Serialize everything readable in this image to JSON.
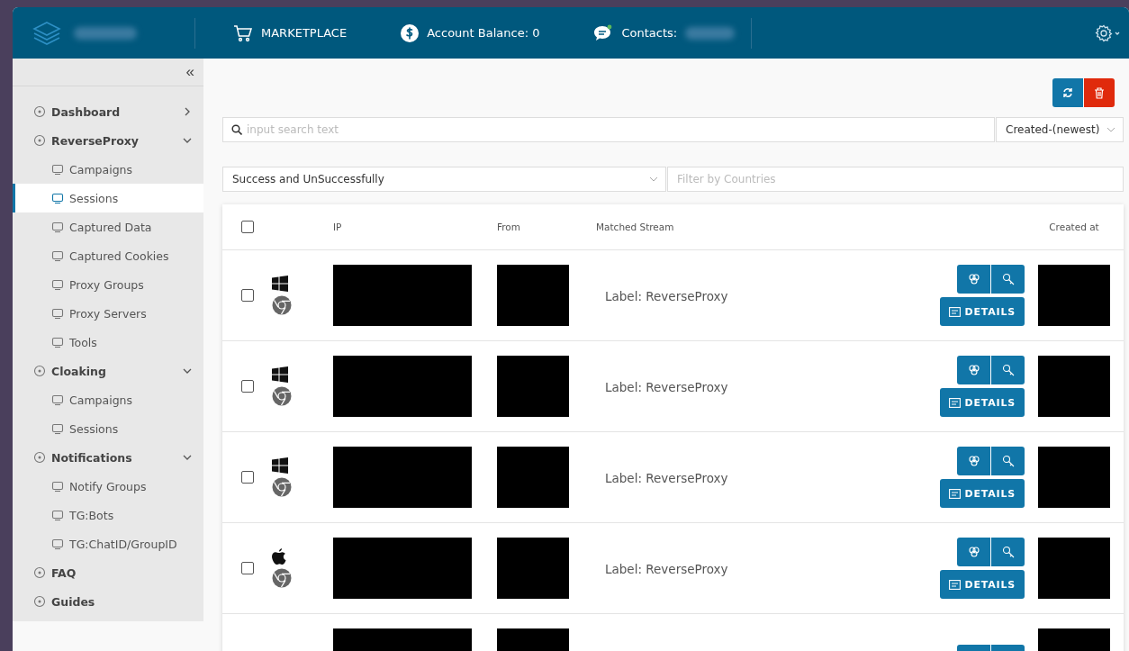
{
  "header": {
    "nav": [
      {
        "kind": "cart",
        "label": "MARKETPLACE"
      },
      {
        "kind": "dollar",
        "label": "Account Balance: 0"
      },
      {
        "kind": "chat",
        "label": "Contacts:"
      }
    ]
  },
  "sidebar": {
    "collapse": "«",
    "items": [
      {
        "label": "Dashboard",
        "expanded": false,
        "selected": false
      },
      {
        "label": "ReverseProxy",
        "expanded": true,
        "selected": false,
        "children": [
          {
            "label": "Campaigns",
            "selected": false
          },
          {
            "label": "Sessions",
            "selected": true
          },
          {
            "label": "Captured Data",
            "selected": false
          },
          {
            "label": "Captured Cookies",
            "selected": false
          },
          {
            "label": "Proxy Groups",
            "selected": false
          },
          {
            "label": "Proxy Servers",
            "selected": false
          },
          {
            "label": "Tools",
            "selected": false
          }
        ]
      },
      {
        "label": "Cloaking",
        "expanded": true,
        "selected": false,
        "children": [
          {
            "label": "Campaigns",
            "selected": false
          },
          {
            "label": "Sessions",
            "selected": false
          }
        ]
      },
      {
        "label": "Notifications",
        "expanded": true,
        "selected": false,
        "children": [
          {
            "label": "Notify Groups",
            "selected": false
          },
          {
            "label": "TG:Bots",
            "selected": false
          },
          {
            "label": "TG:ChatID/GroupID",
            "selected": false
          }
        ]
      },
      {
        "label": "FAQ",
        "selected": false
      },
      {
        "label": "Guides",
        "selected": false
      }
    ]
  },
  "search": {
    "placeholder": "input search text"
  },
  "sort": {
    "value": "Created-(newest)"
  },
  "status_filter": {
    "value": "Success and UnSuccessfully"
  },
  "country_filter": {
    "placeholder": "Filter by Countries"
  },
  "table": {
    "select_all": {
      "checked": false
    },
    "columns": [
      "IP",
      "From",
      "Matched Stream",
      "Created at"
    ],
    "rows": [
      {
        "checked": false,
        "os": {
          "kind": "windows"
        },
        "browser": {
          "kind": "chrome"
        },
        "stream": "Label: ReverseProxy",
        "action": "DETAILS"
      },
      {
        "checked": false,
        "os": {
          "kind": "windows"
        },
        "browser": {
          "kind": "chrome"
        },
        "stream": "Label: ReverseProxy",
        "action": "DETAILS"
      },
      {
        "checked": false,
        "os": {
          "kind": "windows"
        },
        "browser": {
          "kind": "chrome"
        },
        "stream": "Label: ReverseProxy",
        "action": "DETAILS"
      },
      {
        "checked": false,
        "os": {
          "kind": "apple"
        },
        "browser": {
          "kind": "chrome"
        },
        "stream": "Label: ReverseProxy",
        "action": "DETAILS"
      },
      {}
    ]
  }
}
